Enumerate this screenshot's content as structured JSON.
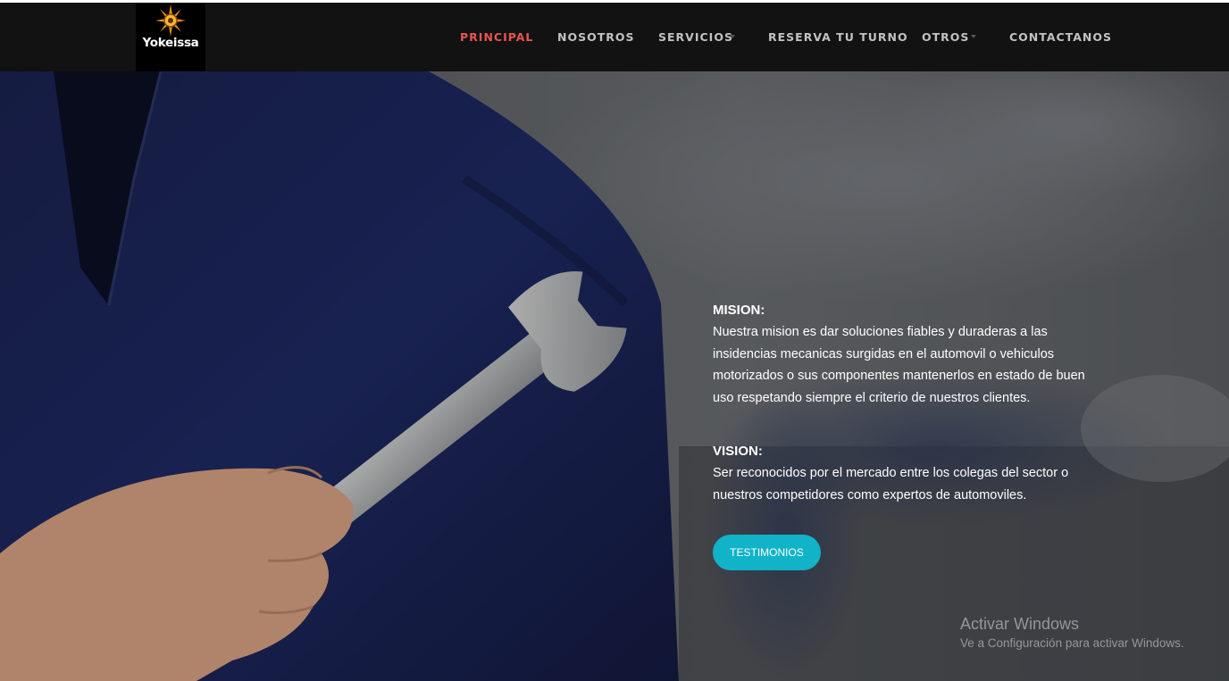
{
  "brand": {
    "name": "Yokeissa"
  },
  "nav": {
    "items": [
      {
        "label": "PRINCIPAL",
        "active": true,
        "has_dropdown": false
      },
      {
        "label": "NOSOTROS",
        "active": false,
        "has_dropdown": false
      },
      {
        "label": "SERVICIOS",
        "active": false,
        "has_dropdown": true
      },
      {
        "label": "RESERVA TU TURNO",
        "active": false,
        "has_dropdown": false
      },
      {
        "label": "OTROS",
        "active": false,
        "has_dropdown": true
      },
      {
        "label": "CONTACTANOS",
        "active": false,
        "has_dropdown": false
      }
    ]
  },
  "hero": {
    "mision": {
      "heading": "MISION:",
      "text": "Nuestra mision es dar soluciones fiables y duraderas a las insidencias mecanicas surgidas en el automovil o vehiculos motorizados o sus componentes mantenerlos en estado de buen uso respetando siempre el criterio de nuestros clientes."
    },
    "vision": {
      "heading": "VISION:",
      "text": "Ser reconocidos por el mercado entre los colegas del sector o nuestros competidores como expertos de automoviles."
    },
    "button_label": "TESTIMONIOS"
  },
  "watermark": {
    "title": "Activar Windows",
    "subtitle": "Ve a Configuración para activar Windows."
  },
  "colors": {
    "navbar_bg": "#121212",
    "nav_text": "#c2c2c2",
    "nav_active": "#e8544f",
    "accent_button": "#10b3c8"
  }
}
